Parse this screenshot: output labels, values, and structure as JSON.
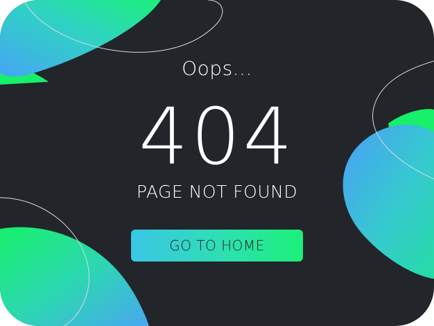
{
  "page": {
    "eyebrow": "Oops...",
    "error_code": "404",
    "message": "PAGE NOT FOUND",
    "home_button_label": "GO TO HOME"
  },
  "colors": {
    "background": "#22252a",
    "accent_blue": "#4aa8f5",
    "accent_green": "#16f06a",
    "text": "#ffffff"
  }
}
